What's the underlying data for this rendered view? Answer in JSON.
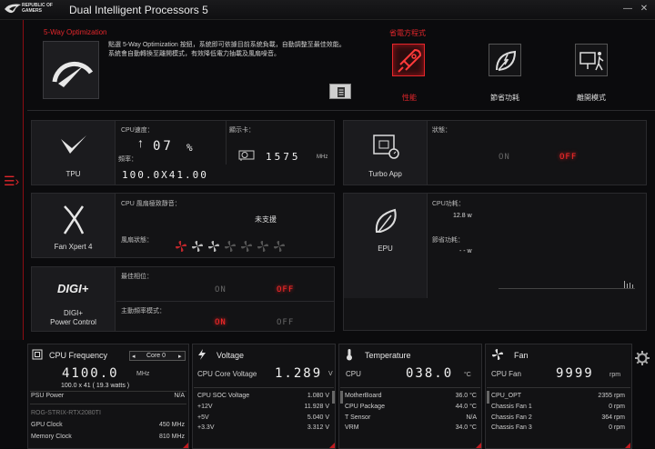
{
  "app": {
    "logo_text": "REPUBLIC OF GAMERS",
    "title": "Dual Intelligent Processors 5",
    "minimize": "—",
    "close": "✕"
  },
  "optimization": {
    "label": "5-Way Optimization",
    "description": "點選 5-Way Optimization 按鈕，系統即可依據目前系統負載，自動調整至最佳效能。系統會自動轉換至離開模式，有效降低電力抽載及風扇噪音。"
  },
  "power_modes": {
    "label": "省電方程式",
    "items": [
      {
        "label": "性能",
        "icon": "rocket-icon",
        "active": true
      },
      {
        "label": "節省功耗",
        "icon": "leaf-power-icon",
        "active": false
      },
      {
        "label": "離開模式",
        "icon": "away-icon",
        "active": false
      }
    ]
  },
  "tpu": {
    "label": "TPU",
    "cpu_speed_label": "CPU速度：",
    "cpu_speed_value": "07",
    "cpu_speed_unit": "%",
    "freq_label": "頻率：",
    "freq_value": "100.0X41.00",
    "gpu_label": "顯示卡：",
    "gpu_value": "1575",
    "gpu_unit": "MHz"
  },
  "turbo_app": {
    "label": "Turbo App",
    "status_label": "狀態：",
    "on": "ON",
    "off": "OFF"
  },
  "fan_xpert": {
    "label": "Fan Xpert 4",
    "cpu_fan_label": "CPU 風扇極致靜音：",
    "cpu_fan_value": "未支援",
    "fan_status_label": "風扇狀態："
  },
  "epu": {
    "label": "EPU",
    "cpu_power_label": "CPU功耗：",
    "cpu_power_value": "12.8 w",
    "saved_power_label": "節省功耗：",
    "saved_power_value": "- - w"
  },
  "digi": {
    "label_line1": "DIGI+",
    "label_line2": "Power Control",
    "best_phase_label": "最佳相位：",
    "best_phase_on": "ON",
    "best_phase_off": "OFF",
    "active_freq_label": "主動頻率模式：",
    "active_freq_on": "ON",
    "active_freq_off": "OFF"
  },
  "cpu_freq": {
    "title": "CPU Frequency",
    "selector": "Core 0",
    "value": "4100.0",
    "unit": "MHz",
    "detail": "100.0  x  41   ( 19.3 watts )",
    "psu_label": "PSU Power",
    "psu_value": "N/A",
    "gpu_name": "ROG-STRIX-RTX2080TI",
    "gpu_clock_label": "GPU Clock",
    "gpu_clock_value": "450 MHz",
    "memory_clock_label": "Memory Clock",
    "memory_clock_value": "810 MHz"
  },
  "voltage": {
    "title": "Voltage",
    "main_label": "CPU Core Voltage",
    "main_value": "1.289",
    "main_unit": "V",
    "rows": [
      {
        "label": "CPU SOC Voltage",
        "value": "1.080  V"
      },
      {
        "label": "+12V",
        "value": "11.928  V"
      },
      {
        "label": "+5V",
        "value": "5.040  V"
      },
      {
        "label": "+3.3V",
        "value": "3.312  V"
      }
    ]
  },
  "temperature": {
    "title": "Temperature",
    "main_label": "CPU",
    "main_value": "038.0",
    "main_unit": "°C",
    "rows": [
      {
        "label": "MotherBoard",
        "value": "36.0 °C"
      },
      {
        "label": "CPU Package",
        "value": "44.0 °C"
      },
      {
        "label": "T Sensor",
        "value": "N/A"
      },
      {
        "label": "VRM",
        "value": "34.0 °C"
      }
    ]
  },
  "fan": {
    "title": "Fan",
    "main_label": "CPU Fan",
    "main_value": "9999",
    "main_unit": "rpm",
    "rows": [
      {
        "label": "CPU_OPT",
        "value": "2355  rpm"
      },
      {
        "label": "Chassis Fan 1",
        "value": "0  rpm"
      },
      {
        "label": "Chassis Fan 2",
        "value": "364  rpm"
      },
      {
        "label": "Chassis Fan 3",
        "value": "0  rpm"
      }
    ]
  },
  "colors": {
    "accent": "#e3262b",
    "background": "#0b0b0d"
  }
}
